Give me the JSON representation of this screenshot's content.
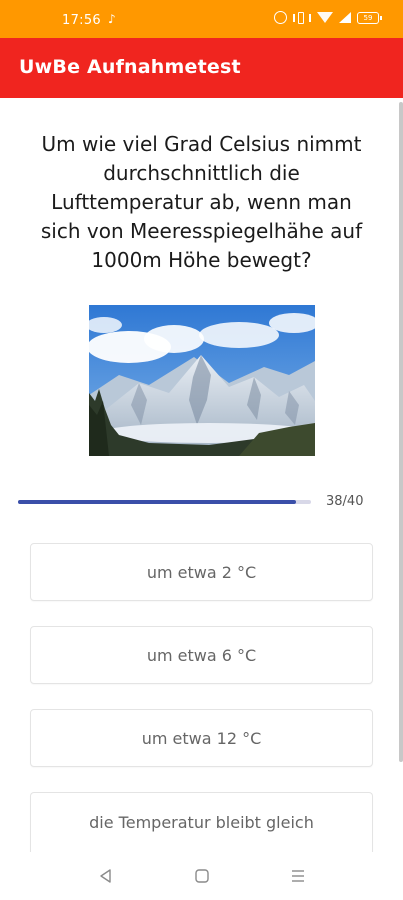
{
  "status_bar": {
    "time": "17:56",
    "battery": "59"
  },
  "app_bar": {
    "title": "UwBe Aufnahmetest"
  },
  "question": {
    "text": "Um wie viel Grad Celsius nimmt durchschnittlich die Lufttemperatur ab, wenn man sich von Meeresspiegelhähe auf 1000m Höhe bewegt?"
  },
  "progress": {
    "current": 38,
    "total": 40,
    "label": "38/40"
  },
  "answers": [
    {
      "label": "um etwa 2 °C"
    },
    {
      "label": "um etwa 6 °C"
    },
    {
      "label": "um etwa 12 °C"
    },
    {
      "label": "die Temperatur bleibt gleich"
    }
  ],
  "colors": {
    "status_bar": "#ff9800",
    "app_bar": "#f0251f",
    "progress_fill": "#3a4fa9",
    "progress_track": "#d8d8e8"
  },
  "icons": {
    "status": [
      "tiktok-icon",
      "alarm-icon",
      "vibrate-icon",
      "wifi-icon",
      "signal-icon",
      "battery-icon"
    ],
    "nav": [
      "back-icon",
      "home-icon",
      "recent-apps-icon"
    ]
  }
}
